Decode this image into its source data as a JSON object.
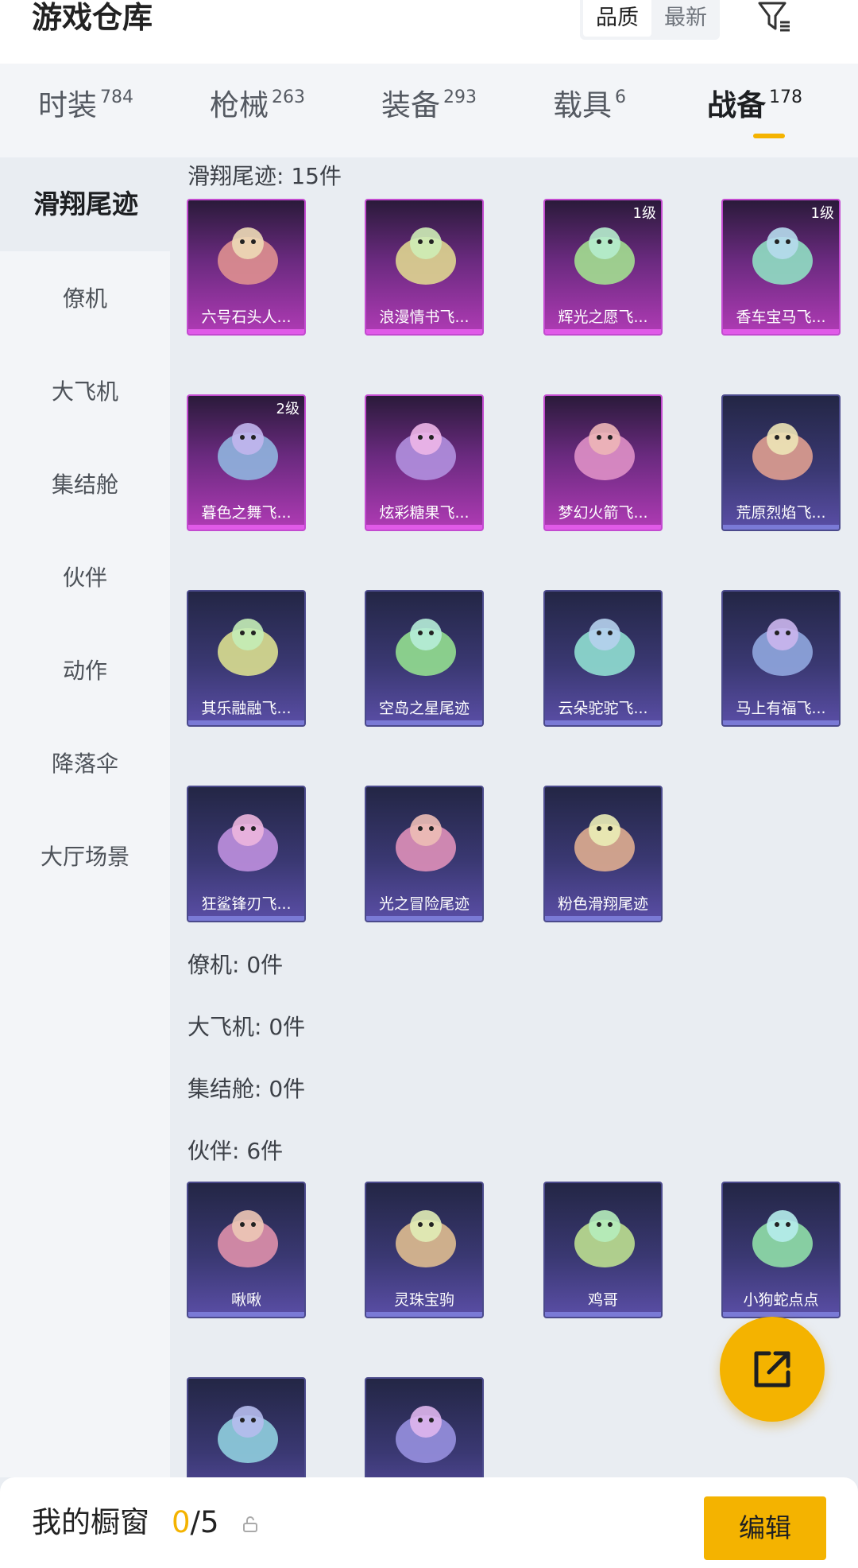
{
  "header": {
    "title": "游戏仓库",
    "sort_options": [
      "品质",
      "最新"
    ],
    "sort_selected": "品质",
    "filter_icon": "filter-icon"
  },
  "tabs": [
    {
      "label": "时装",
      "count": "784"
    },
    {
      "label": "枪械",
      "count": "263"
    },
    {
      "label": "装备",
      "count": "293"
    },
    {
      "label": "载具",
      "count": "6"
    },
    {
      "label": "战备",
      "count": "178",
      "active": true
    }
  ],
  "sidebar": {
    "items": [
      "滑翔尾迹",
      "僚机",
      "大飞机",
      "集结舱",
      "伙伴",
      "动作",
      "降落伞",
      "大厅场景"
    ],
    "active": "滑翔尾迹"
  },
  "sections": {
    "glide": {
      "title": "滑翔尾迹: 15件"
    },
    "wingman": {
      "title": "僚机: 0件"
    },
    "bigplane": {
      "title": "大飞机: 0件"
    },
    "pod": {
      "title": "集结舱: 0件"
    },
    "partner": {
      "title": "伙伴: 6件"
    }
  },
  "glide_items": [
    {
      "name": "六号石头人...",
      "rarity": "purple",
      "level": ""
    },
    {
      "name": "浪漫情书飞...",
      "rarity": "purple",
      "level": ""
    },
    {
      "name": "辉光之愿飞...",
      "rarity": "purple",
      "level": "1级"
    },
    {
      "name": "香车宝马飞...",
      "rarity": "purple",
      "level": "1级"
    },
    {
      "name": "暮色之舞飞...",
      "rarity": "purple",
      "level": "2级"
    },
    {
      "name": "炫彩糖果飞...",
      "rarity": "purple",
      "level": ""
    },
    {
      "name": "梦幻火箭飞...",
      "rarity": "purple",
      "level": ""
    },
    {
      "name": "荒原烈焰飞...",
      "rarity": "blue",
      "level": ""
    },
    {
      "name": "其乐融融飞...",
      "rarity": "blue",
      "level": ""
    },
    {
      "name": "空岛之星尾迹",
      "rarity": "blue",
      "level": ""
    },
    {
      "name": "云朵驼驼飞...",
      "rarity": "blue",
      "level": ""
    },
    {
      "name": "马上有福飞...",
      "rarity": "blue",
      "level": ""
    },
    {
      "name": "狂鲨锋刃飞...",
      "rarity": "blue",
      "level": ""
    },
    {
      "name": "光之冒险尾迹",
      "rarity": "blue",
      "level": ""
    },
    {
      "name": "粉色滑翔尾迹",
      "rarity": "blue",
      "level": ""
    }
  ],
  "partner_items": [
    {
      "name": "啾啾",
      "rarity": "blue"
    },
    {
      "name": "灵珠宝驹",
      "rarity": "blue"
    },
    {
      "name": "鸡哥",
      "rarity": "blue"
    },
    {
      "name": "小狗蛇点点",
      "rarity": "blue"
    },
    {
      "name": "",
      "rarity": "blue"
    },
    {
      "name": "",
      "rarity": "blue"
    }
  ],
  "footer": {
    "showcase_label": "我的橱窗",
    "showcase_current": "0",
    "showcase_total": "/5",
    "edit_label": "编辑"
  },
  "colors": {
    "accent": "#f4b300",
    "rarity_purple": "#b03bb5",
    "rarity_blue": "#4b4a8c"
  },
  "icons": {
    "share": "share-icon",
    "lock": "lock-icon"
  }
}
